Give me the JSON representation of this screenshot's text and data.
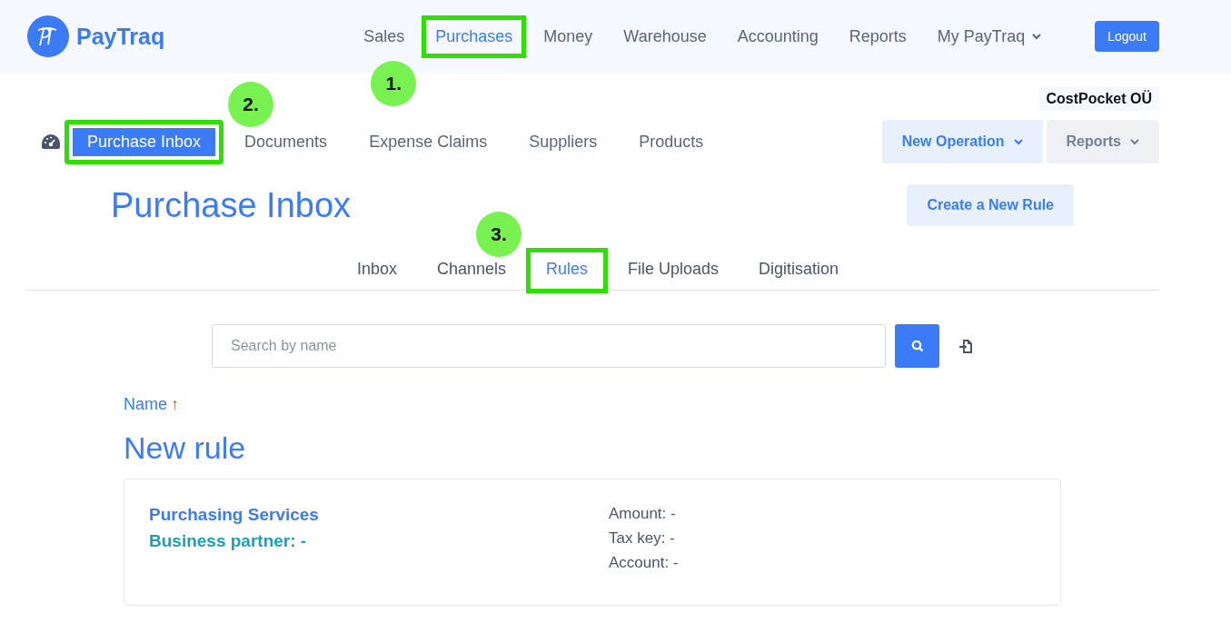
{
  "header": {
    "logo": "PayTraq",
    "nav": [
      {
        "label": "Sales",
        "selected": false,
        "highlighted": false
      },
      {
        "label": "Purchases",
        "selected": true,
        "highlighted": true,
        "step": "1."
      },
      {
        "label": "Money",
        "selected": false,
        "highlighted": false
      },
      {
        "label": "Warehouse",
        "selected": false,
        "highlighted": false
      },
      {
        "label": "Accounting",
        "selected": false,
        "highlighted": false
      },
      {
        "label": "Reports",
        "selected": false,
        "highlighted": false
      },
      {
        "label": "My PayTraq",
        "selected": false,
        "highlighted": false,
        "dropdown": true
      }
    ],
    "logout": "Logout"
  },
  "company": "CostPocket OÜ",
  "subnav": [
    {
      "label": "Purchase Inbox",
      "selected": true,
      "highlighted": true,
      "step": "2."
    },
    {
      "label": "Documents",
      "selected": false,
      "highlighted": false
    },
    {
      "label": "Expense Claims",
      "selected": false,
      "highlighted": false
    },
    {
      "label": "Suppliers",
      "selected": false,
      "highlighted": false
    },
    {
      "label": "Products",
      "selected": false,
      "highlighted": false
    }
  ],
  "actions": [
    {
      "label": "New Operation",
      "kind": "primary"
    },
    {
      "label": "Reports",
      "kind": "secondary"
    }
  ],
  "page": {
    "title": "Purchase Inbox",
    "create_button": "Create a New Rule"
  },
  "tabs": [
    {
      "label": "Inbox",
      "selected": false,
      "highlighted": false
    },
    {
      "label": "Channels",
      "selected": false,
      "highlighted": false
    },
    {
      "label": "Rules",
      "selected": true,
      "highlighted": true,
      "step": "3."
    },
    {
      "label": "File Uploads",
      "selected": false,
      "highlighted": false
    },
    {
      "label": "Digitisation",
      "selected": false,
      "highlighted": false
    }
  ],
  "search": {
    "placeholder": "Search by name"
  },
  "sort": {
    "label": "Name",
    "arrow": "↑"
  },
  "group_title": "New rule",
  "rules": [
    {
      "name": "Purchasing Services",
      "partner": "Business partner: -",
      "details": [
        "Amount: -",
        "Tax key: -",
        "Account: -"
      ]
    }
  ]
}
